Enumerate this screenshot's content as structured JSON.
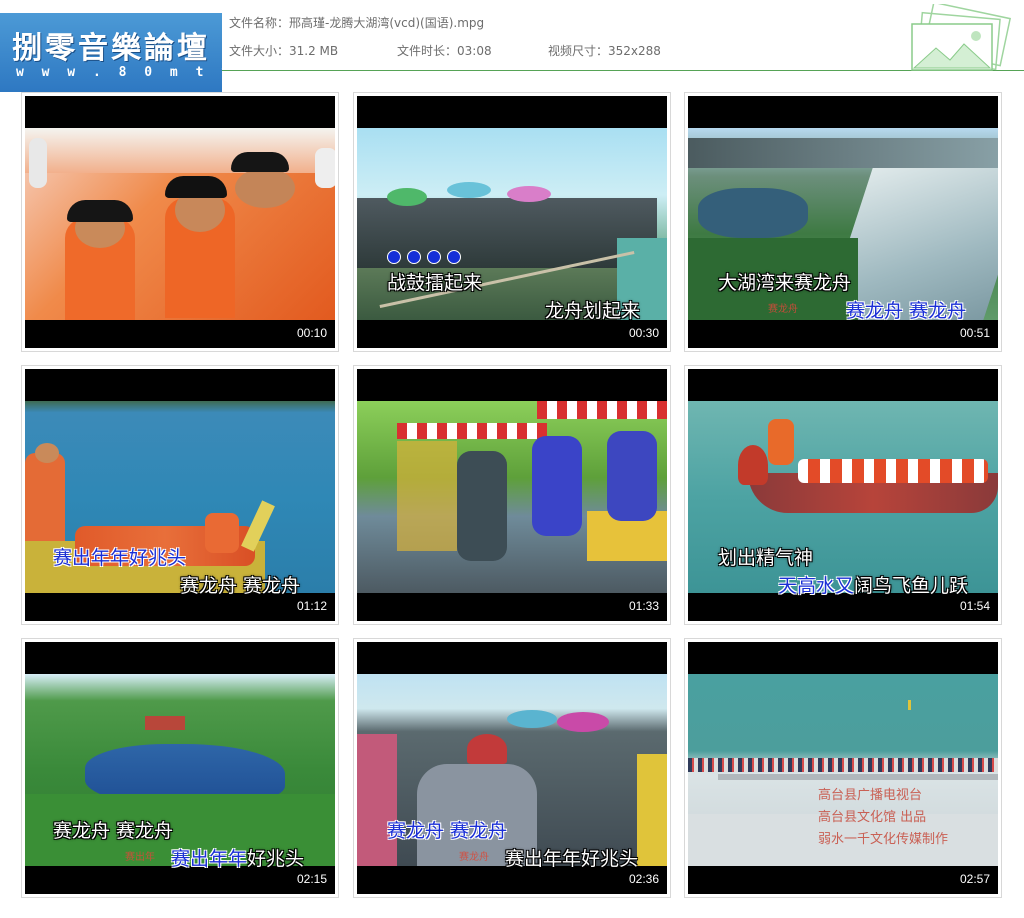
{
  "logo": {
    "name": "捌零音樂論壇",
    "url": "w w w . 8 0 m t v . c o m"
  },
  "file_info": {
    "name_label": "文件名称：",
    "name_value": "邢高瑾-龙腾大湖湾(vcd)(国语).mpg",
    "size_label": "文件大小：",
    "size_value": "31.2 MB",
    "duration_label": "文件时长：",
    "duration_value": "03:08",
    "dims_label": "视频尺寸：",
    "dims_value": "352x288"
  },
  "colors": {
    "accent_line": "#56a356",
    "logo_bg": "#2e78c2",
    "lyric_highlight": "#1a2fd6"
  },
  "thumbnails": [
    {
      "time": "00:10",
      "lyrics": []
    },
    {
      "time": "00:30",
      "lyrics": [
        "战鼓擂起来",
        "龙舟划起来"
      ]
    },
    {
      "time": "00:51",
      "lyrics": [
        "大湖湾来赛龙舟",
        "赛龙舟",
        "赛龙舟",
        "赛龙舟"
      ]
    },
    {
      "time": "01:12",
      "lyrics": [
        "赛出年年好兆头",
        "赛龙舟  赛龙舟"
      ]
    },
    {
      "time": "01:33",
      "lyrics": []
    },
    {
      "time": "01:54",
      "lyrics": [
        "划出精气神",
        "天高水又",
        "阔鸟飞鱼儿跃"
      ]
    },
    {
      "time": "02:15",
      "lyrics": [
        "赛龙舟  赛龙舟",
        "赛出年年",
        "好兆头",
        "赛出年"
      ]
    },
    {
      "time": "02:36",
      "lyrics": [
        "赛龙舟  赛龙舟",
        "赛出年年好兆头",
        "赛龙舟"
      ]
    },
    {
      "time": "02:57",
      "lyrics": [
        "高台县广播电视台",
        "高台县文化馆  出品",
        "弱水一千文化传媒制作"
      ]
    }
  ]
}
